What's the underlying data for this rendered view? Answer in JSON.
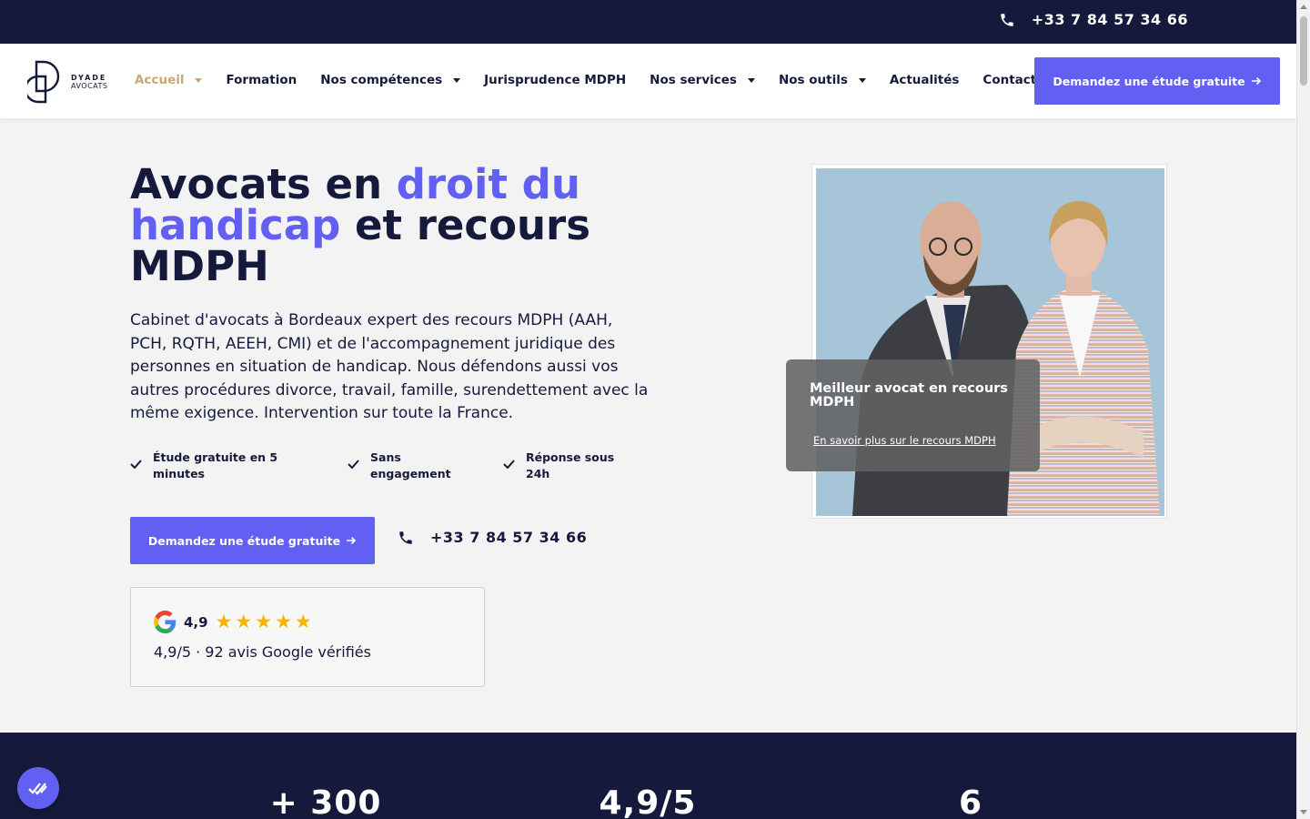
{
  "topbar": {
    "phone": "+33 7 84 57 34 66",
    "phone_icon": "phone-icon"
  },
  "logo": {
    "line1": "DYADE",
    "line2": "AVOCATS"
  },
  "nav": {
    "items": [
      {
        "label": "Accueil",
        "has_dropdown": true,
        "active": true
      },
      {
        "label": "Formation",
        "has_dropdown": false
      },
      {
        "label": "Nos compétences",
        "has_dropdown": true
      },
      {
        "label": "Jurisprudence MDPH",
        "has_dropdown": false
      },
      {
        "label": "Nos services",
        "has_dropdown": true
      },
      {
        "label": "Nos outils",
        "has_dropdown": true
      },
      {
        "label": "Actualités",
        "has_dropdown": false
      },
      {
        "label": "Contact",
        "has_dropdown": false
      }
    ],
    "cta": "Demandez une étude gratuite"
  },
  "hero": {
    "title_part1": "Avocats en ",
    "title_accent": "droit du handicap",
    "title_part2": " et recours MDPH",
    "description": "Cabinet d'avocats à Bordeaux expert des recours MDPH (AAH, PCH, RQTH, AEEH, CMI) et de l'accompagnement juridique des personnes en situation de handicap. Nous défendons aussi vos autres procédures divorce, travail, famille, surendettement avec la même exigence. Intervention sur toute la France.",
    "features": [
      {
        "line1": "Étude gratuite en 5",
        "line2": "minutes"
      },
      {
        "line1": "Sans",
        "line2": "engagement"
      },
      {
        "line1": "Réponse sous",
        "line2": "24h"
      }
    ],
    "cta": "Demandez une étude gratuite",
    "phone": "+33 7 84 57 34 66"
  },
  "review": {
    "score": "4,9",
    "stars": 5,
    "text": "4,9/5 · 92 avis Google vérifiés"
  },
  "photo_card": {
    "title": "Meilleur avocat en recours MDPH",
    "link": "En savoir plus sur le recours MDPH"
  },
  "stats": [
    "+ 300",
    "4,9/5",
    "6"
  ],
  "colors": {
    "navy": "#151a3c",
    "accent": "#6160f2",
    "gold": "#c7a777",
    "star": "#f5b400"
  }
}
